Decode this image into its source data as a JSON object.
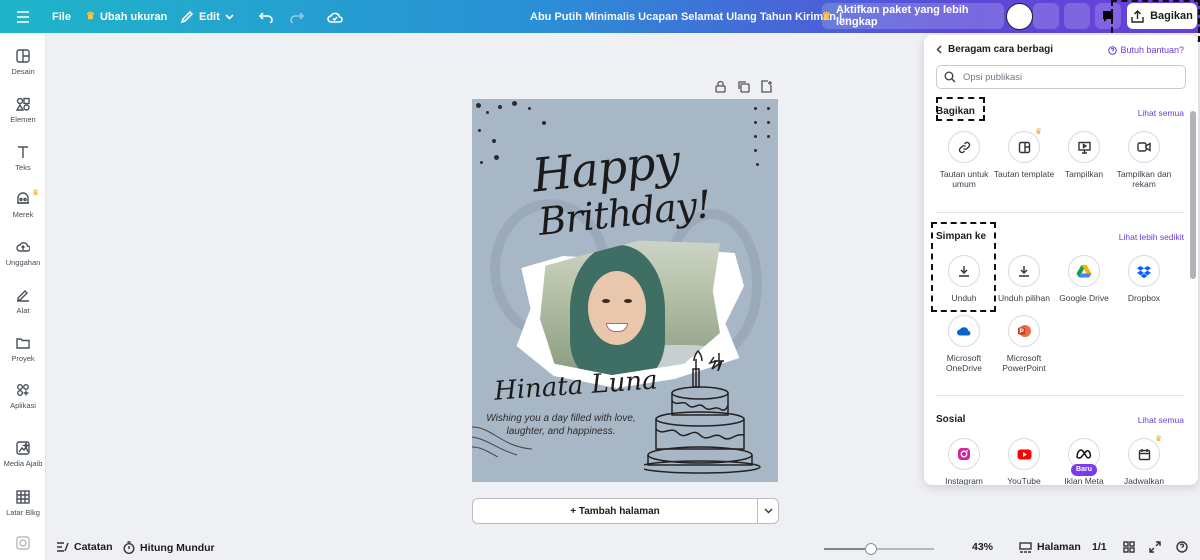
{
  "topbar": {
    "file": "File",
    "resize": "Ubah ukuran",
    "edit": "Edit",
    "doc_title": "Abu Putih Minimalis Ucapan Selamat Ulang Tahun Kiriman I...",
    "upgrade": "Aktifkan paket yang lebih lengkap",
    "share": "Bagikan"
  },
  "sidebar": {
    "items": [
      {
        "label": "Desain",
        "icon": "design-icon"
      },
      {
        "label": "Elemen",
        "icon": "elements-icon"
      },
      {
        "label": "Teks",
        "icon": "text-icon"
      },
      {
        "label": "Merek",
        "icon": "brand-icon"
      },
      {
        "label": "Unggahan",
        "icon": "upload-icon"
      },
      {
        "label": "Alat",
        "icon": "draw-icon"
      },
      {
        "label": "Proyek",
        "icon": "folder-icon"
      },
      {
        "label": "Aplikasi",
        "icon": "apps-icon"
      },
      {
        "label": "Media Ajaib",
        "icon": "magic-media-icon"
      },
      {
        "label": "Latar Blkg",
        "icon": "background-icon"
      }
    ]
  },
  "design": {
    "happy": "Happy",
    "birthday": "Brithday!",
    "name": "Hinata Luna",
    "wish": "Wishing you a day filled with love, laughter, and happiness."
  },
  "canvas": {
    "add_page": "+ Tambah halaman"
  },
  "bottombar": {
    "notes": "Catatan",
    "timer": "Hitung Mundur",
    "zoom": "43%",
    "zoom_level": 0.43,
    "pages_label": "Halaman",
    "page_count": "1/1"
  },
  "share_panel": {
    "back_title": "Beragam cara berbagi",
    "help": "Butuh bantuan?",
    "search_placeholder": "Opsi publikasi",
    "share_section": {
      "title": "Bagikan",
      "see_all": "Lihat semua",
      "options": [
        {
          "label": "Tautan untuk umum",
          "icon": "link-icon"
        },
        {
          "label": "Tautan template",
          "icon": "template-link-icon",
          "premium": true
        },
        {
          "label": "Tampilkan",
          "icon": "present-icon"
        },
        {
          "label": "Tampilkan dan rekam",
          "icon": "record-icon"
        }
      ]
    },
    "save_section": {
      "title": "Simpan ke",
      "see_less": "Lihat lebih sedikit",
      "options": [
        {
          "label": "Unduh",
          "icon": "download-icon"
        },
        {
          "label": "Unduh pilihan",
          "icon": "download-selection-icon"
        },
        {
          "label": "Google Drive",
          "icon": "google-drive-icon"
        },
        {
          "label": "Dropbox",
          "icon": "dropbox-icon"
        },
        {
          "label": "Microsoft OneDrive",
          "icon": "onedrive-icon"
        },
        {
          "label": "Microsoft PowerPoint",
          "icon": "powerpoint-icon"
        }
      ]
    },
    "social_section": {
      "title": "Sosial",
      "see_all": "Lihat semua",
      "options": [
        {
          "label": "Instagram",
          "icon": "instagram-icon"
        },
        {
          "label": "YouTube",
          "icon": "youtube-icon"
        },
        {
          "label": "Iklan Meta",
          "icon": "meta-icon",
          "badge": "Baru"
        },
        {
          "label": "Jadwalkan",
          "icon": "calendar-icon",
          "premium": true
        }
      ]
    }
  },
  "colors": {
    "accent": "#6b3fd8",
    "topbar_start": "#1fb5c9",
    "topbar_end": "#6a3fd9",
    "crown": "#f5a623",
    "design_bg": "#a8b7c6"
  }
}
